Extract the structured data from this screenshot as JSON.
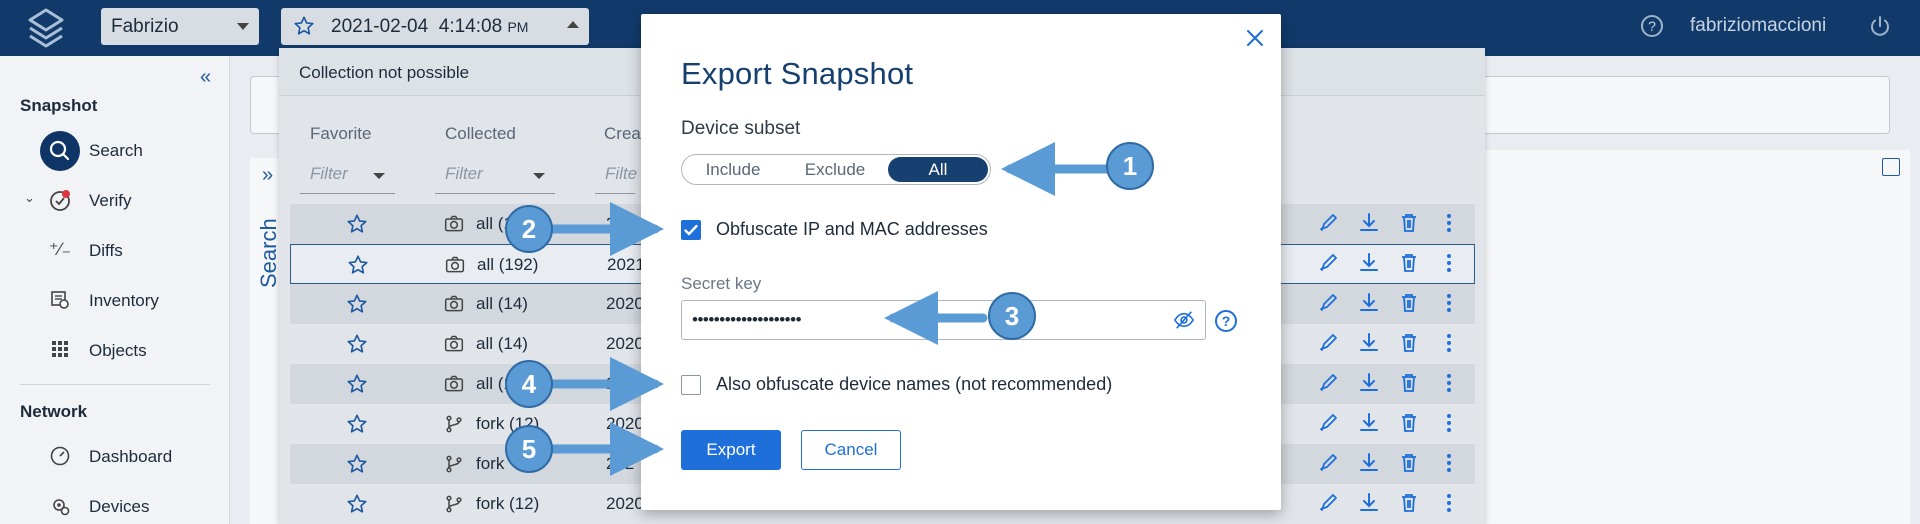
{
  "topbar": {
    "user": "Fabrizio",
    "snapshot_date": "2021-02-04",
    "snapshot_time": "4:14:08",
    "snapshot_ampm": "PM",
    "help_glyph": "?",
    "username": "fabriziomaccioni"
  },
  "sidebar": {
    "snapshot_title": "Snapshot",
    "network_title": "Network",
    "items": [
      {
        "label": "Search",
        "icon": "search-icon"
      },
      {
        "label": "Verify",
        "icon": "verify-icon"
      },
      {
        "label": "Diffs",
        "icon": "diffs-icon"
      },
      {
        "label": "Inventory",
        "icon": "inventory-icon"
      },
      {
        "label": "Objects",
        "icon": "objects-icon"
      },
      {
        "label": "Dashboard",
        "icon": "dashboard-icon"
      },
      {
        "label": "Devices",
        "icon": "devices-icon"
      }
    ]
  },
  "main": {
    "side_tab_label": "Search"
  },
  "collection": {
    "status": "Collection not possible",
    "columns": {
      "favorite": "Favorite",
      "collected": "Collected",
      "created": "Crea"
    },
    "filter_placeholder": "Filter",
    "created_filter_placeholder": "Filte",
    "rows": [
      {
        "collected": "all (1",
        "created": "20"
      },
      {
        "collected": "all (192)",
        "created": "2021"
      },
      {
        "collected": "all (14)",
        "created": "2020"
      },
      {
        "collected": "all (14)",
        "created": "2020"
      },
      {
        "collected": "all (1",
        "created": "20"
      },
      {
        "collected": "fork (12)",
        "created": "2020"
      },
      {
        "collected": "fork",
        "created": "202"
      },
      {
        "collected": "fork (12)",
        "created": "2020"
      }
    ]
  },
  "modal": {
    "title": "Export Snapshot",
    "device_subset_label": "Device subset",
    "segments": [
      "Include",
      "Exclude",
      "All"
    ],
    "selected_segment": "All",
    "obfuscate_label": "Obfuscate IP and MAC addresses",
    "obfuscate_checked": true,
    "secret_label": "Secret key",
    "secret_value": "••••••••••••••••••••",
    "secret_help": "?",
    "obfuscate_names_label": "Also obfuscate device names (not recommended)",
    "obfuscate_names_checked": false,
    "export_label": "Export",
    "cancel_label": "Cancel"
  },
  "callouts": [
    "1",
    "2",
    "3",
    "4",
    "5"
  ],
  "colors": {
    "topbar": "#113a6b",
    "primary": "#1e6fd9",
    "callout": "#5b9bd5",
    "title": "#16406f"
  }
}
